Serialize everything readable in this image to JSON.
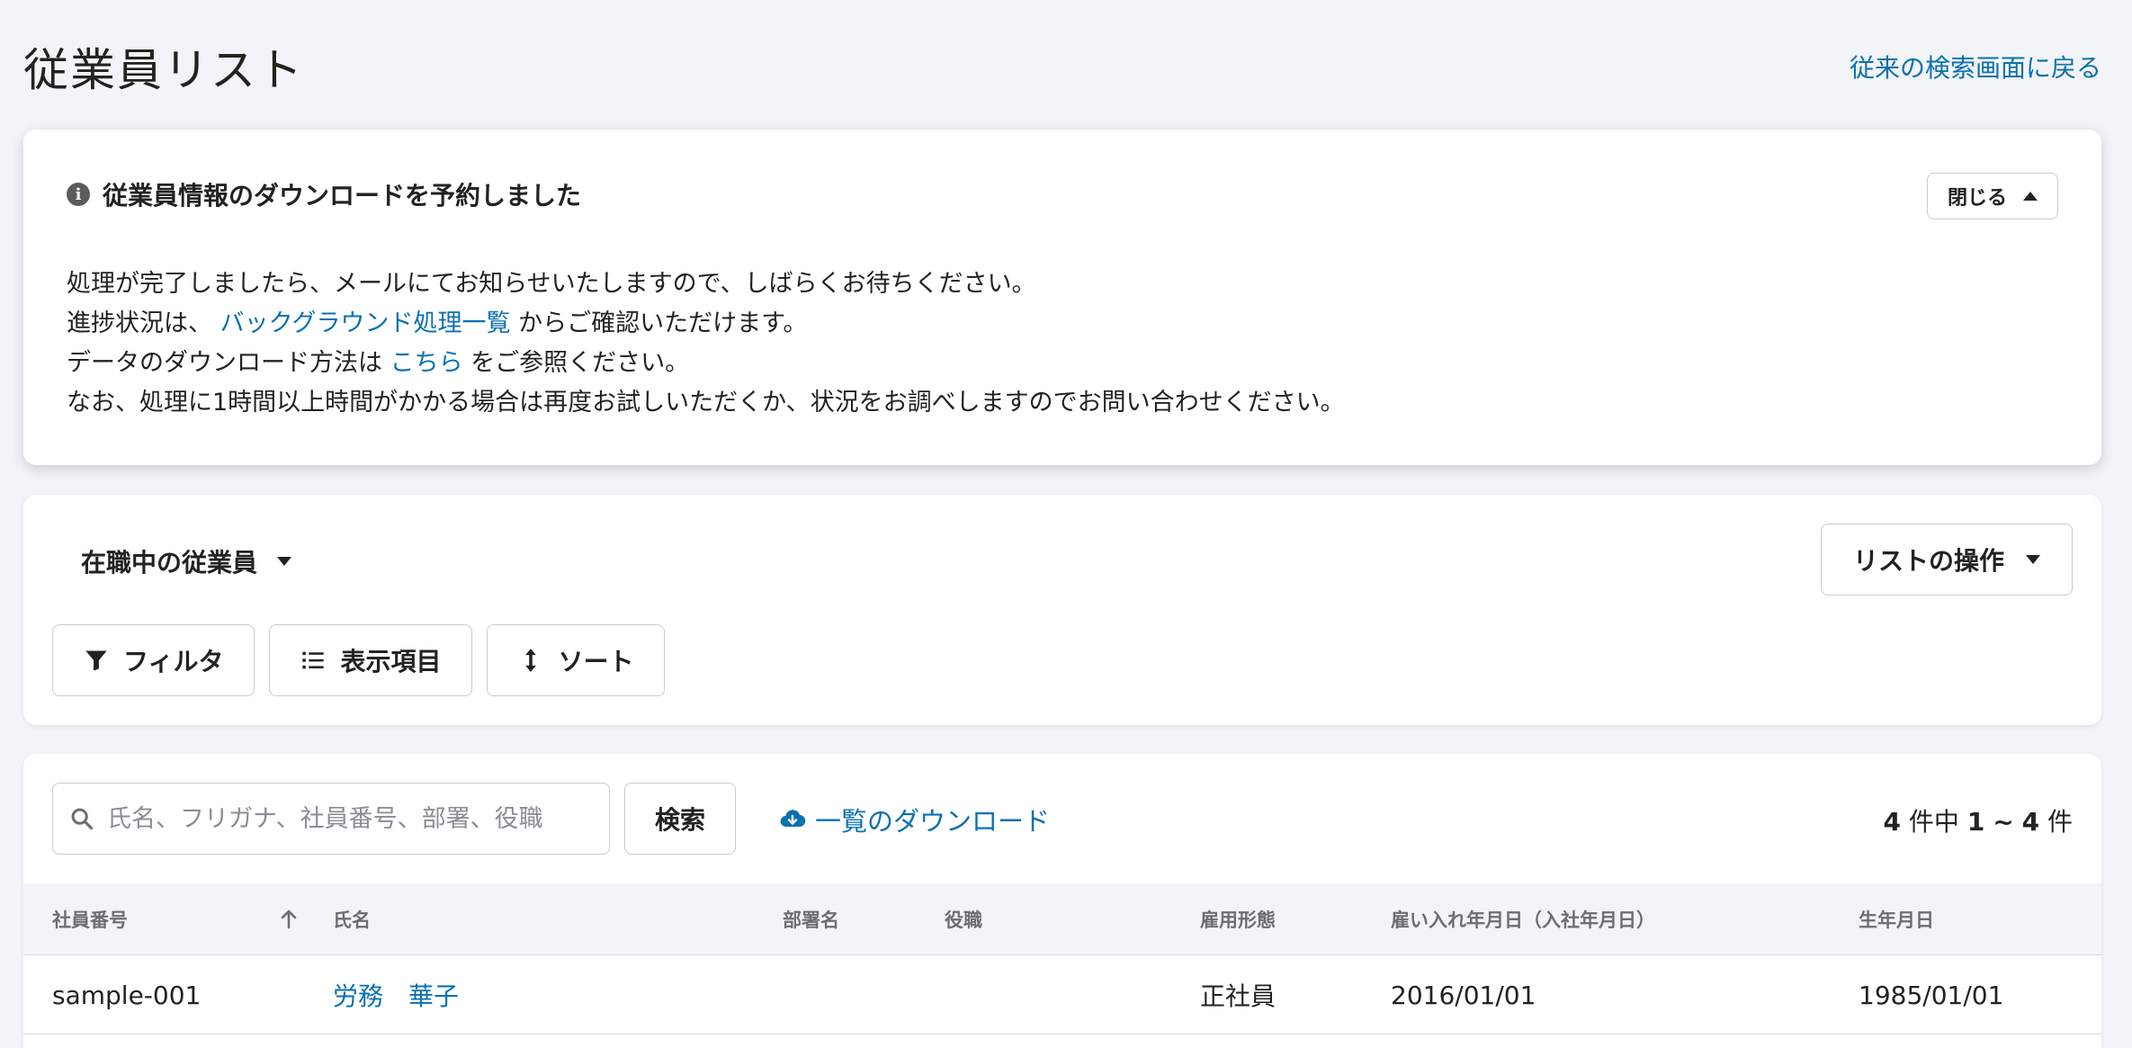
{
  "header": {
    "title": "従業員リスト",
    "back_link": "従来の検索画面に戻る"
  },
  "notice": {
    "icon": "info-icon",
    "title": "従業員情報のダウンロードを予約しました",
    "close_label": "閉じる",
    "line1": "処理が完了しましたら、メールにてお知らせいたしますので、しばらくお待ちください。",
    "line2_prefix": "進捗状況は、",
    "line2_link": "バックグラウンド処理一覧",
    "line2_suffix": "からご確認いただけます。",
    "line3_prefix": "データのダウンロード方法は",
    "line3_link": "こちら",
    "line3_suffix": "をご参照ください。",
    "line4": "なお、処理に1時間以上時間がかかる場合は再度お試しいただくか、状況をお調べしますのでお問い合わせください。"
  },
  "list": {
    "selected_list": "在職中の従業員",
    "operations_label": "リストの操作",
    "filter_label": "フィルタ",
    "columns_label": "表示項目",
    "sort_label": "ソート"
  },
  "search": {
    "placeholder": "氏名、フリガナ、社員番号、部署、役職",
    "button_label": "検索",
    "download_label": "一覧のダウンロード",
    "count_total": "4",
    "count_mid": "件中",
    "count_from": "1",
    "count_sep": "~",
    "count_to": "4",
    "count_unit": "件"
  },
  "table": {
    "headers": {
      "employee_no": "社員番号",
      "name": "氏名",
      "department": "部署名",
      "position": "役職",
      "employment_type": "雇用形態",
      "hire_date": "雇い入れ年月日（入社年月日）",
      "birth_date": "生年月日"
    },
    "rows": [
      {
        "employee_no": "sample-001",
        "name": "労務　華子",
        "department": "",
        "position": "",
        "employment_type": "正社員",
        "hire_date": "2016/01/01",
        "birth_date": "1985/01/01"
      }
    ]
  },
  "colors": {
    "link": "#0a71b0",
    "background": "#f2f4f8",
    "text": "#23221f"
  }
}
